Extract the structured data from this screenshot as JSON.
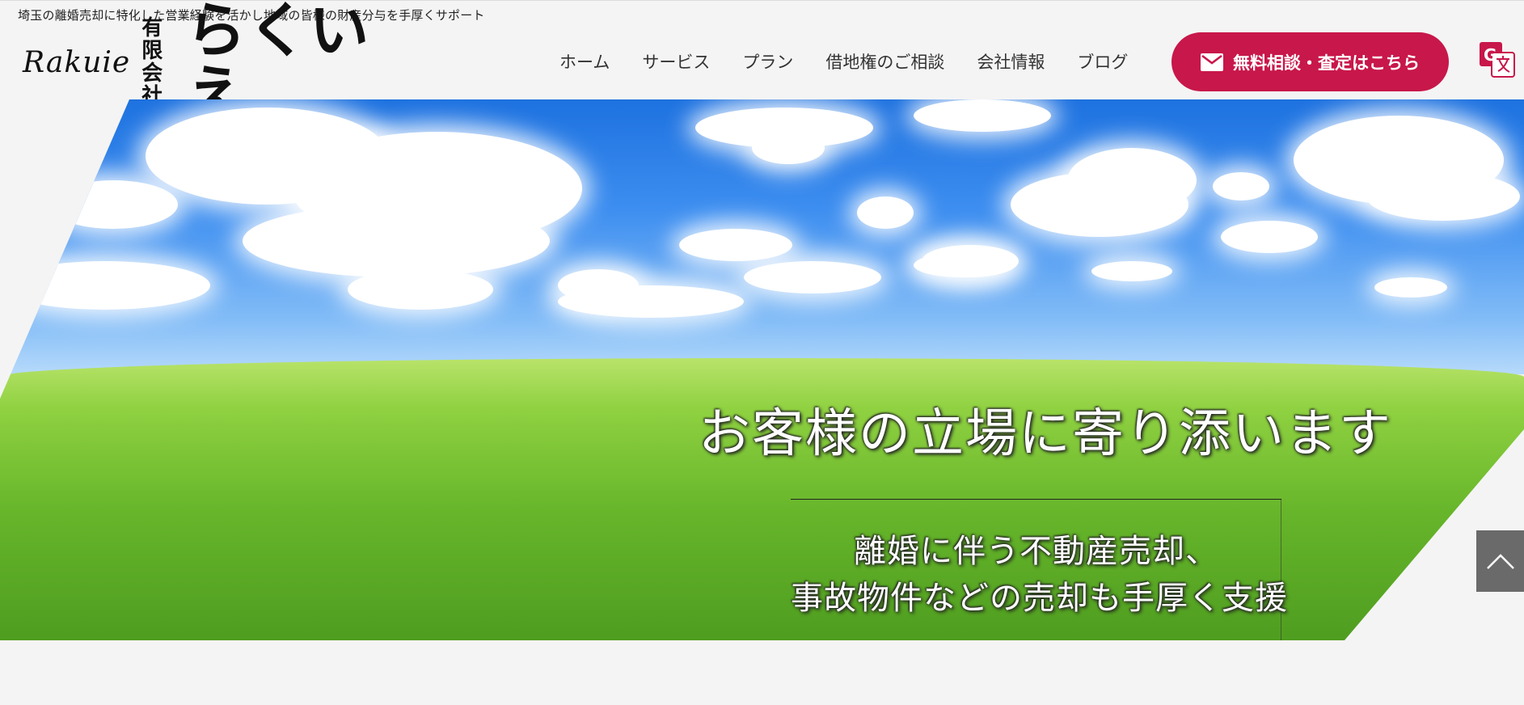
{
  "header": {
    "tagline": "埼玉の離婚売却に特化した営業経験を活かし地域の皆様の財産分与を手厚くサポート",
    "logo": {
      "latin": "Rakuie",
      "kaisha_top": "有限",
      "kaisha_bottom": "会社",
      "name": "らくいえ"
    },
    "nav": [
      {
        "label": "ホーム"
      },
      {
        "label": "サービス"
      },
      {
        "label": "プラン"
      },
      {
        "label": "借地権のご相談"
      },
      {
        "label": "会社情報"
      },
      {
        "label": "ブログ"
      }
    ],
    "cta_label": "無料相談・査定はこちら",
    "cta_icon": "mail-icon",
    "translate_icon": "google-translate-icon"
  },
  "hero": {
    "headline": "お客様の立場に寄り添います",
    "sub_line_1": "離婚に伴う不動産売却、",
    "sub_line_2": "事故物件などの売却も手厚く支援"
  },
  "colors": {
    "accent": "#c8174a",
    "background": "#f4f4f4",
    "scroll_button": "#6a6a6a"
  },
  "scroll_top_icon": "chevron-up-icon"
}
